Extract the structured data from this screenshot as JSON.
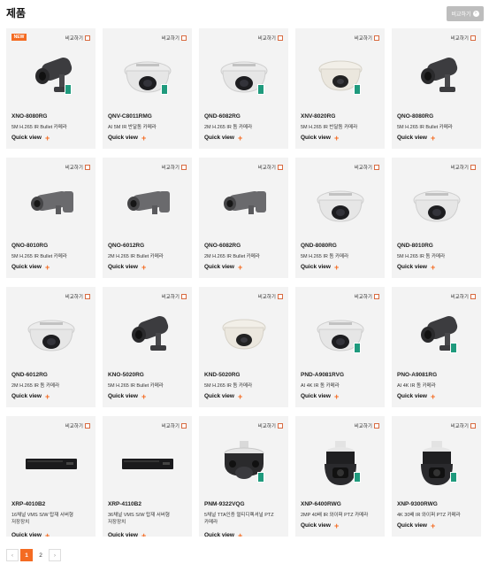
{
  "page": {
    "title": "제품",
    "compare_all_label": "비교하기"
  },
  "compare_label": "비교하기",
  "quick_view_label": "Quick view",
  "badge_label": "NEW",
  "colors": {
    "accent": "#f46b22",
    "card_bg": "#f3f3f3",
    "cert": "#1f9a7d"
  },
  "products": [
    {
      "model": "XNO-8080RG",
      "desc": "5M H.265 IR Bullet 카메라",
      "icon": "bullet-camera-dark",
      "badge": true,
      "cert": true
    },
    {
      "model": "QNV-C8011RMG",
      "desc": "AI 5M IR 반달돔 카메라",
      "icon": "dome-camera-white",
      "badge": false,
      "cert": true
    },
    {
      "model": "QND-6082RG",
      "desc": "2M H.265 IR 돔 카메라",
      "icon": "dome-camera-white",
      "badge": false,
      "cert": true
    },
    {
      "model": "XNV-8020RG",
      "desc": "5M H.265 IR 반달돔 카메라",
      "icon": "dome-camera-ivory",
      "badge": false,
      "cert": true
    },
    {
      "model": "QNO-8080RG",
      "desc": "5M H.265 IR Bullet 카메라",
      "icon": "bullet-camera-dark",
      "badge": false,
      "cert": false
    },
    {
      "model": "QNO-8010RG",
      "desc": "5M H.265 IR Bullet 카메라",
      "icon": "bullet-camera-grey",
      "badge": false,
      "cert": false
    },
    {
      "model": "QNO-6012RG",
      "desc": "2M H.265 IR Bullet 카메라",
      "icon": "bullet-camera-grey",
      "badge": false,
      "cert": false
    },
    {
      "model": "QNO-6082RG",
      "desc": "2M H.265 IR Bullet 카메라",
      "icon": "bullet-camera-grey",
      "badge": false,
      "cert": false
    },
    {
      "model": "QND-8080RG",
      "desc": "5M H.265 IR 돔 카메라",
      "icon": "dome-camera-white",
      "badge": false,
      "cert": false
    },
    {
      "model": "QND-8010RG",
      "desc": "5M H.265 IR 돔 카메라",
      "icon": "dome-camera-white",
      "badge": false,
      "cert": false
    },
    {
      "model": "QND-6012RG",
      "desc": "2M H.265 IR 돔 카메라",
      "icon": "dome-camera-white",
      "badge": false,
      "cert": false
    },
    {
      "model": "KNO-5020RG",
      "desc": "5M H.265 IR Bullet 카메라",
      "icon": "bullet-camera-dark",
      "badge": false,
      "cert": false
    },
    {
      "model": "KND-5020RG",
      "desc": "5M H.265 IR 돔 카메라",
      "icon": "dome-camera-ivory",
      "badge": false,
      "cert": false
    },
    {
      "model": "PND-A9081RVG",
      "desc": "AI 4K IR 돔 카메라",
      "icon": "dome-camera-white",
      "badge": false,
      "cert": true
    },
    {
      "model": "PNO-A9081RG",
      "desc": "AI 4K IR 돔 카메라",
      "icon": "bullet-camera-dark",
      "badge": false,
      "cert": true
    },
    {
      "model": "XRP-4010B2",
      "desc": "16채널 VMS S/W 탑재 서버형\n저장장치",
      "icon": "nvr-recorder",
      "badge": false,
      "cert": false
    },
    {
      "model": "XRP-4110B2",
      "desc": "36채널 VMS S/W 탑재 서버형\n저장장치",
      "icon": "nvr-recorder",
      "badge": false,
      "cert": false
    },
    {
      "model": "PNM-9322VQG",
      "desc": "5채널 TTA인증 멀티디렉셔널 PTZ\n카메라",
      "icon": "multi-ptz-camera",
      "badge": false,
      "cert": true
    },
    {
      "model": "XNP-6400RWG",
      "desc": "2MP 40배 IR 와이퍼 PTZ 카메라",
      "icon": "ptz-camera-dark",
      "badge": false,
      "cert": true
    },
    {
      "model": "XNP-9300RWG",
      "desc": "4K 30배 IR 와이퍼 PTZ 카메라",
      "icon": "ptz-camera-dark",
      "badge": false,
      "cert": true
    }
  ],
  "pagination": {
    "prev": "‹",
    "pages": [
      "1",
      "2"
    ],
    "current": "1",
    "next": "›"
  }
}
